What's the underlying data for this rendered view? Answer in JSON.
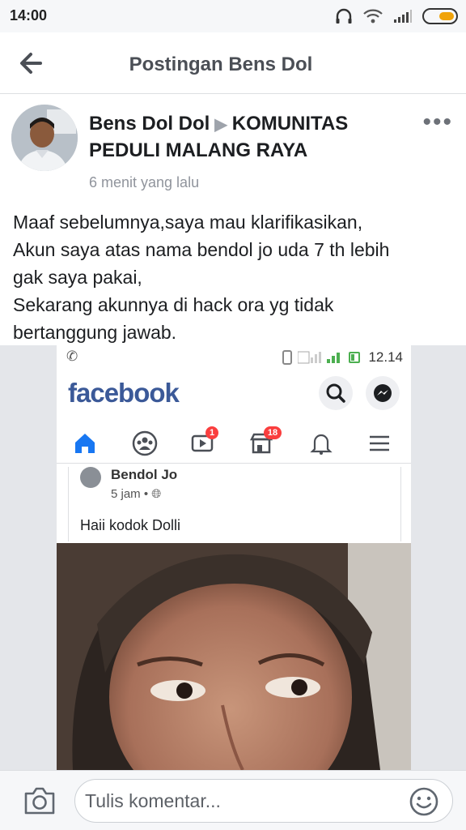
{
  "status_bar": {
    "time": "14:00",
    "icons": [
      "headphones-icon",
      "wifi-icon",
      "signal-icon",
      "battery-icon"
    ],
    "battery_color": "#f0a30a"
  },
  "header": {
    "title": "Postingan Bens Dol",
    "back_icon": "back-arrow-icon"
  },
  "post": {
    "author": "Bens Dol Dol",
    "target_group": "KOMUNITAS PEDULI MALANG RAYA",
    "timestamp": "6 menit yang lalu",
    "text_lines": [
      "Maaf sebelumnya,saya mau klarifikasikan,",
      "Akun saya atas nama bendol jo uda 7 th lebih",
      "gak saya pakai,",
      "Sekarang akunnya di hack ora yg tidak",
      "bertanggung jawab."
    ],
    "more_icon": "more-options-icon"
  },
  "embedded_screenshot": {
    "status_time": "12.14",
    "app_logo": "facebook",
    "brand_color": "#3b5998",
    "nav_badges": {
      "video": "1",
      "marketplace": "18"
    },
    "inner_post": {
      "author": "Bendol Jo",
      "time": "5 jam •",
      "message": "Haii kodok Dolli"
    }
  },
  "comment_bar": {
    "placeholder": "Tulis komentar...",
    "camera_icon": "camera-icon",
    "emoji_icon": "emoji-icon"
  }
}
